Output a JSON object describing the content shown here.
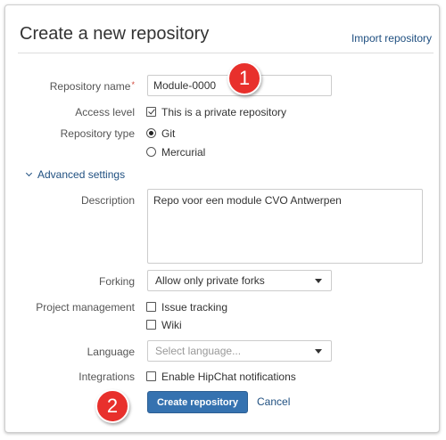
{
  "header": {
    "title": "Create a new repository",
    "import_link": "Import repository"
  },
  "form": {
    "repo_name": {
      "label": "Repository name",
      "required_mark": "*",
      "value": "Module-0000"
    },
    "access_level": {
      "label": "Access level",
      "option": "This is a private repository",
      "checked": true
    },
    "repo_type": {
      "label": "Repository type",
      "options": [
        "Git",
        "Mercurial"
      ],
      "selected": "Git"
    },
    "advanced_toggle": "Advanced settings",
    "description": {
      "label": "Description",
      "value": "Repo voor een module CVO Antwerpen"
    },
    "forking": {
      "label": "Forking",
      "value": "Allow only private forks"
    },
    "project_management": {
      "label": "Project management",
      "options": [
        "Issue tracking",
        "Wiki"
      ]
    },
    "language": {
      "label": "Language",
      "placeholder": "Select language..."
    },
    "integrations": {
      "label": "Integrations",
      "option": "Enable HipChat notifications"
    },
    "create_button": "Create repository",
    "cancel_link": "Cancel"
  },
  "annotations": [
    "1",
    "2"
  ],
  "colors": {
    "link": "#205081",
    "primary_button": "#3572b0",
    "marker": "#e8302c",
    "required": "#d04437"
  }
}
